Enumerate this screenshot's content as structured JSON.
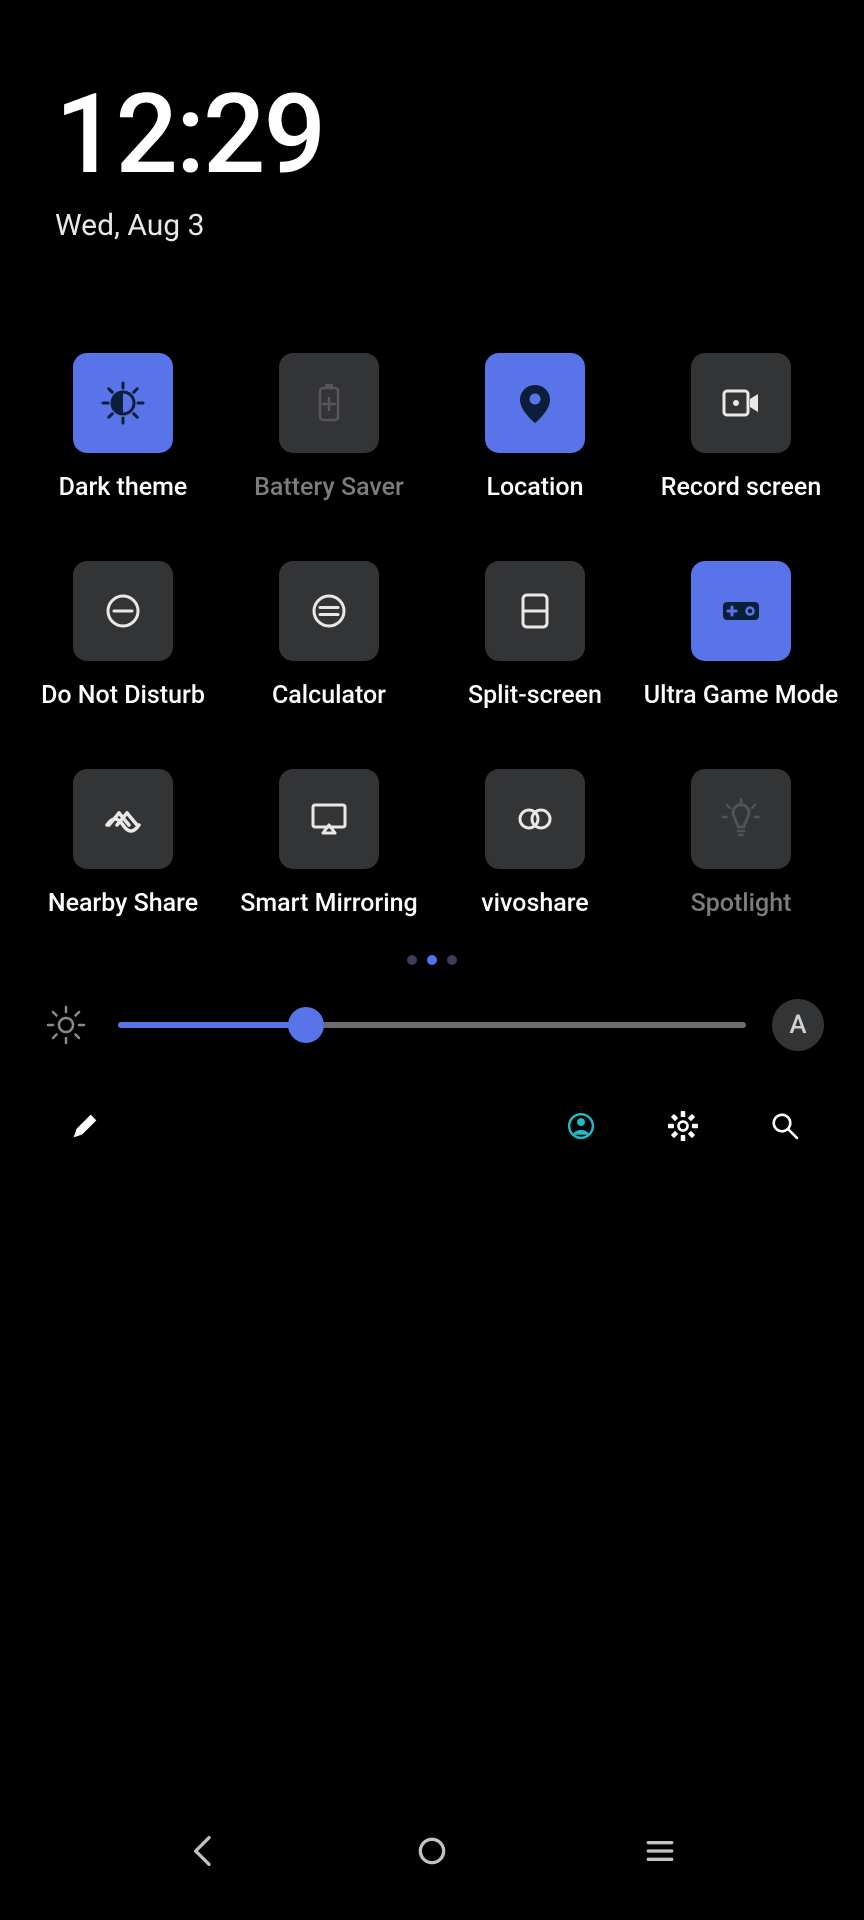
{
  "header": {
    "time": "12:29",
    "date": "Wed, Aug 3"
  },
  "tiles": [
    {
      "id": "dark-theme",
      "label": "Dark theme",
      "active": true,
      "dim": false
    },
    {
      "id": "battery-saver",
      "label": "Battery Saver",
      "active": false,
      "dim": true
    },
    {
      "id": "location",
      "label": "Location",
      "active": true,
      "dim": false
    },
    {
      "id": "record-screen",
      "label": "Record screen",
      "active": false,
      "dim": false
    },
    {
      "id": "dnd",
      "label": "Do Not Disturb",
      "active": false,
      "dim": false
    },
    {
      "id": "calculator",
      "label": "Calculator",
      "active": false,
      "dim": false
    },
    {
      "id": "split-screen",
      "label": "Split-screen",
      "active": false,
      "dim": false
    },
    {
      "id": "ultra-game",
      "label": "Ultra Game Mode",
      "active": true,
      "dim": false
    },
    {
      "id": "nearby-share",
      "label": "Nearby Share",
      "active": false,
      "dim": false
    },
    {
      "id": "smart-mirror",
      "label": "Smart Mirroring",
      "active": false,
      "dim": false
    },
    {
      "id": "vivoshare",
      "label": "vivoshare",
      "active": false,
      "dim": false
    },
    {
      "id": "spotlight",
      "label": "Spotlight",
      "active": false,
      "dim": true
    }
  ],
  "pager": {
    "count": 3,
    "active": 1
  },
  "brightness": {
    "percent": 30,
    "auto_label": "A"
  },
  "colors": {
    "accent": "#5874e8",
    "tile_off": "#333436",
    "user_ring": "#1fbdc9"
  }
}
